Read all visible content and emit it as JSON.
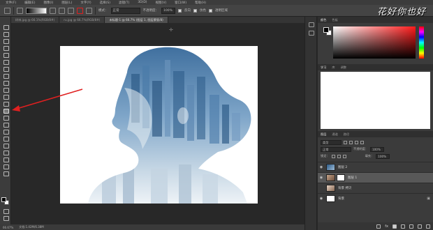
{
  "menubar": {
    "items": [
      "文件(F)",
      "编辑(E)",
      "图像(I)",
      "图层(L)",
      "文字(Y)",
      "选择(S)",
      "滤镜(T)",
      "3D(D)",
      "视图(V)",
      "窗口(W)",
      "帮助(H)"
    ]
  },
  "options": {
    "mode_label": "模式：",
    "mode_value": "正常",
    "opacity_label": "不透明度：",
    "opacity_value": "100%",
    "reverse_label": "反向",
    "dither_label": "仿色",
    "transparency_label": "透明区域"
  },
  "logo_text": "花好你也好",
  "tabs": [
    {
      "label": "树林.jpg @ 66.1%(RGB/8#)"
    },
    {
      "label": "ru.jpg @ 66.7%(RGB/8#)"
    },
    {
      "label": "未标题-1 @ 66.7% (图层 1, 图层蒙版/8)"
    }
  ],
  "status": {
    "zoom": "66.67%",
    "doc": "文档:1.42M/6.38M"
  },
  "color_panel": {
    "tab_color": "颜色",
    "tab_swatches": "色板"
  },
  "learn_panel": {
    "tab_learn": "学习",
    "tab_libraries": "库",
    "tab_adjustments": "调整"
  },
  "layers_panel": {
    "tab_layers": "图层",
    "tab_channels": "通道",
    "tab_paths": "路径",
    "filter_kind": "类型",
    "blend_mode": "正常",
    "opacity_label": "不透明度：",
    "opacity_value": "100%",
    "lock_label": "锁定：",
    "fill_label": "填充：",
    "fill_value": "100%",
    "layers": [
      {
        "name": "图层 2",
        "visible": true
      },
      {
        "name": "图层 1",
        "visible": true,
        "selected": true,
        "mask": true
      },
      {
        "name": "背景 拷贝",
        "visible": false
      },
      {
        "name": "背景",
        "visible": true,
        "locked": true
      }
    ],
    "fx_label": "fx"
  },
  "colors": {
    "accent_red": "#e02020"
  }
}
